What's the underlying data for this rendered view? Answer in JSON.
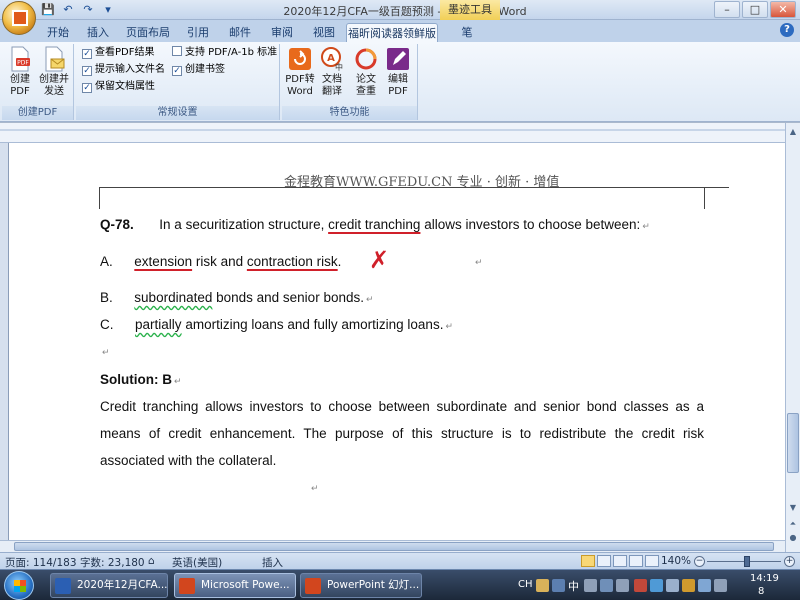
{
  "window": {
    "title": "2020年12月CFA一级百题预测 - Microsoft Word",
    "context_tab": "墨迹工具",
    "buttons": [
      "–",
      "□",
      "✕"
    ]
  },
  "quick_access": [
    "💾",
    "↶",
    "↷",
    "▾"
  ],
  "tabs": [
    "开始",
    "插入",
    "页面布局",
    "引用",
    "邮件",
    "审阅",
    "视图",
    "福昕阅读器领鲜版",
    "笔"
  ],
  "active_tab": "福昕阅读器领鲜版",
  "ribbon": {
    "groups": [
      {
        "label": "创建PDF",
        "buttons": [
          {
            "line1": "创建",
            "line2": "PDF"
          },
          {
            "line1": "创建并",
            "line2": "发送"
          }
        ]
      },
      {
        "label": "常规设置",
        "checkboxes": [
          {
            "label": "查看PDF结果",
            "checked": true
          },
          {
            "label": "提示输入文件名",
            "checked": true
          },
          {
            "label": "保留文档属性",
            "checked": true
          },
          {
            "label": "支持 PDF/A-1b 标准",
            "checked": false
          },
          {
            "label": "创建书签",
            "checked": true
          }
        ]
      },
      {
        "label": "特色功能",
        "buttons": [
          {
            "line1": "PDF转",
            "line2": "Word",
            "color": "#e86a1c"
          },
          {
            "line1": "文档",
            "line2": "翻译",
            "color": "#d04a1a"
          },
          {
            "line1": "论文",
            "line2": "查重",
            "color": "#d83a2a"
          },
          {
            "line1": "编辑",
            "line2": "PDF",
            "color": "#7a2a8a"
          }
        ]
      }
    ]
  },
  "document": {
    "header": "金程教育WWW.GFEDU.CN 专业 · 创新 · 增值",
    "question": {
      "label": "Q-78.",
      "text_before": "In a securitization structure, ",
      "underlined": "credit tranching",
      "text_after": " allows investors to choose between:"
    },
    "options": [
      {
        "letter": "A.",
        "parts": [
          "extension",
          " risk and ",
          "contraction risk",
          "."
        ],
        "mark": "✗"
      },
      {
        "letter": "B.",
        "parts": [
          "subordinated",
          " bonds and senior bonds."
        ]
      },
      {
        "letter": "C.",
        "parts": [
          "partially",
          " amortizing loans and fully amortizing loans."
        ]
      }
    ],
    "solution_label": "Solution: B",
    "solution_text": "Credit tranching allows investors to choose between subordinate and senior bond classes as a means of credit enhancement. The purpose of this structure is to redistribute the credit risk associated with the collateral.",
    "paragraph_mark": "↵"
  },
  "status_bar": {
    "page": "页面: 114/183",
    "words": "字数: 23,180",
    "language": "英语(美国)",
    "mode": "插入",
    "zoom": "140%",
    "zoom_level_percent": 140
  },
  "taskbar": {
    "items": [
      {
        "label": "2020年12月CFA...",
        "icon_color": "#2b5fb3"
      },
      {
        "label": "Microsoft Powe...",
        "icon_color": "#d2461e",
        "active": true
      },
      {
        "label": "PowerPoint 幻灯...",
        "icon_color": "#d2461e"
      }
    ],
    "tray_lang": "CH",
    "tray_ime": "中",
    "time": "14:19",
    "date_short": "8"
  }
}
